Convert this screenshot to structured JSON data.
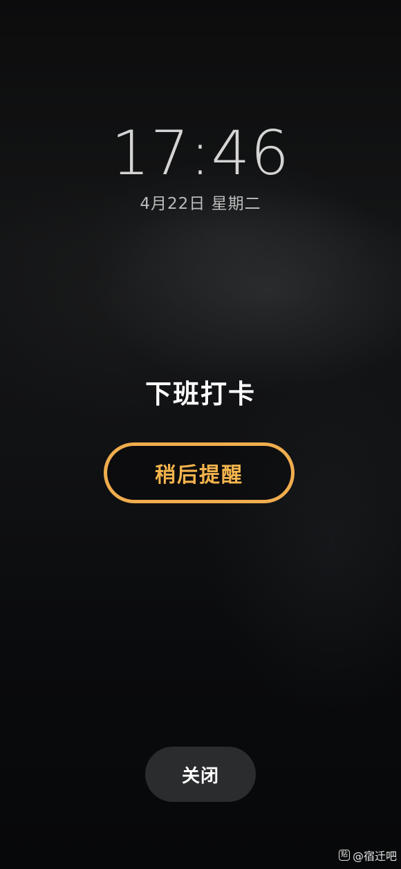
{
  "lockscreen": {
    "time": "17:46",
    "date": "4月22日 星期二"
  },
  "alarm": {
    "title": "下班打卡",
    "snooze_label": "稍后提醒",
    "close_label": "关闭"
  },
  "watermark": {
    "logo_text": "贴",
    "text": "@宿迁吧"
  },
  "colors": {
    "accent": "#f0ad4e",
    "background": "#0a0b0c",
    "close_button_bg": "#2b2c2e"
  }
}
